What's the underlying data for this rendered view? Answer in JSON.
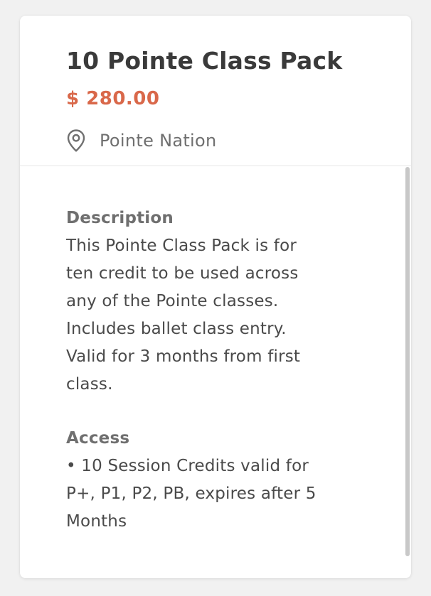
{
  "product": {
    "title": "10 Pointe Class Pack",
    "price": "$ 280.00",
    "location": "Pointe Nation"
  },
  "description": {
    "heading": "Description",
    "lines": [
      "This Pointe Class Pack is for",
      "ten credit to be used across",
      "any of the Pointe classes.",
      "Includes ballet class entry.",
      "Valid for 3 months from first",
      "class."
    ]
  },
  "access": {
    "heading": "Access",
    "lines": [
      "• 10 Session Credits valid for",
      "P+, P1, P2, PB, expires after 5",
      "Months"
    ]
  },
  "icons": {
    "location": "map-pin-icon"
  },
  "colors": {
    "price": "#d9684a",
    "title": "#3a3a3a",
    "muted": "#6f6f6f"
  }
}
